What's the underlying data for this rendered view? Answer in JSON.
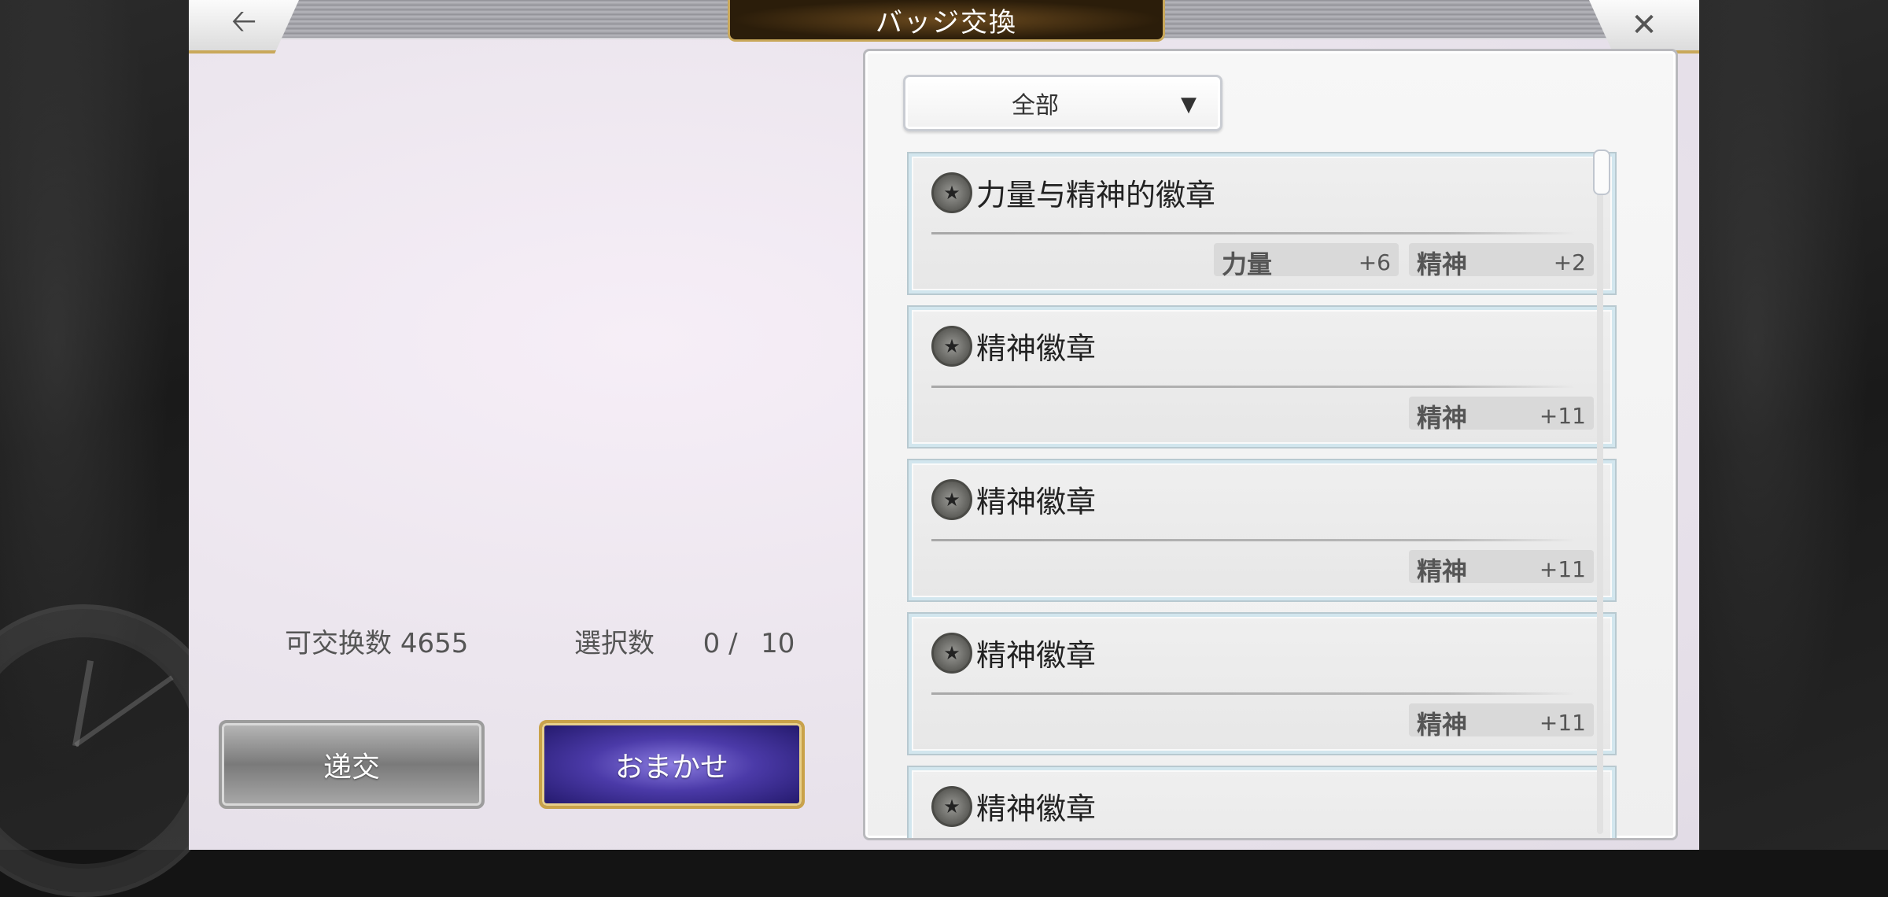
{
  "header": {
    "title": "バッジ交換",
    "back_icon": "arrow-left-icon",
    "close_icon": "close-icon"
  },
  "summary": {
    "exchangeable_label": "可交换数",
    "exchangeable_value": "4655",
    "selected_label": "選択数",
    "selected_value": "0 /",
    "selected_max": "10"
  },
  "buttons": {
    "exchange_label": "递交",
    "auto_label": "おまかせ"
  },
  "filter": {
    "selected": "全部"
  },
  "badges": [
    {
      "name": "力量与精神的徽章",
      "stats": [
        {
          "name": "力量",
          "value": "+6"
        },
        {
          "name": "精神",
          "value": "+2"
        }
      ]
    },
    {
      "name": "精神徽章",
      "stats": [
        {
          "name": "精神",
          "value": "+11"
        }
      ]
    },
    {
      "name": "精神徽章",
      "stats": [
        {
          "name": "精神",
          "value": "+11"
        }
      ]
    },
    {
      "name": "精神徽章",
      "stats": [
        {
          "name": "精神",
          "value": "+11"
        }
      ]
    },
    {
      "name": "精神徽章",
      "stats": []
    }
  ],
  "colors": {
    "gold_accent": "#c9a85a",
    "auto_button_purple": "#4b3aa8"
  }
}
